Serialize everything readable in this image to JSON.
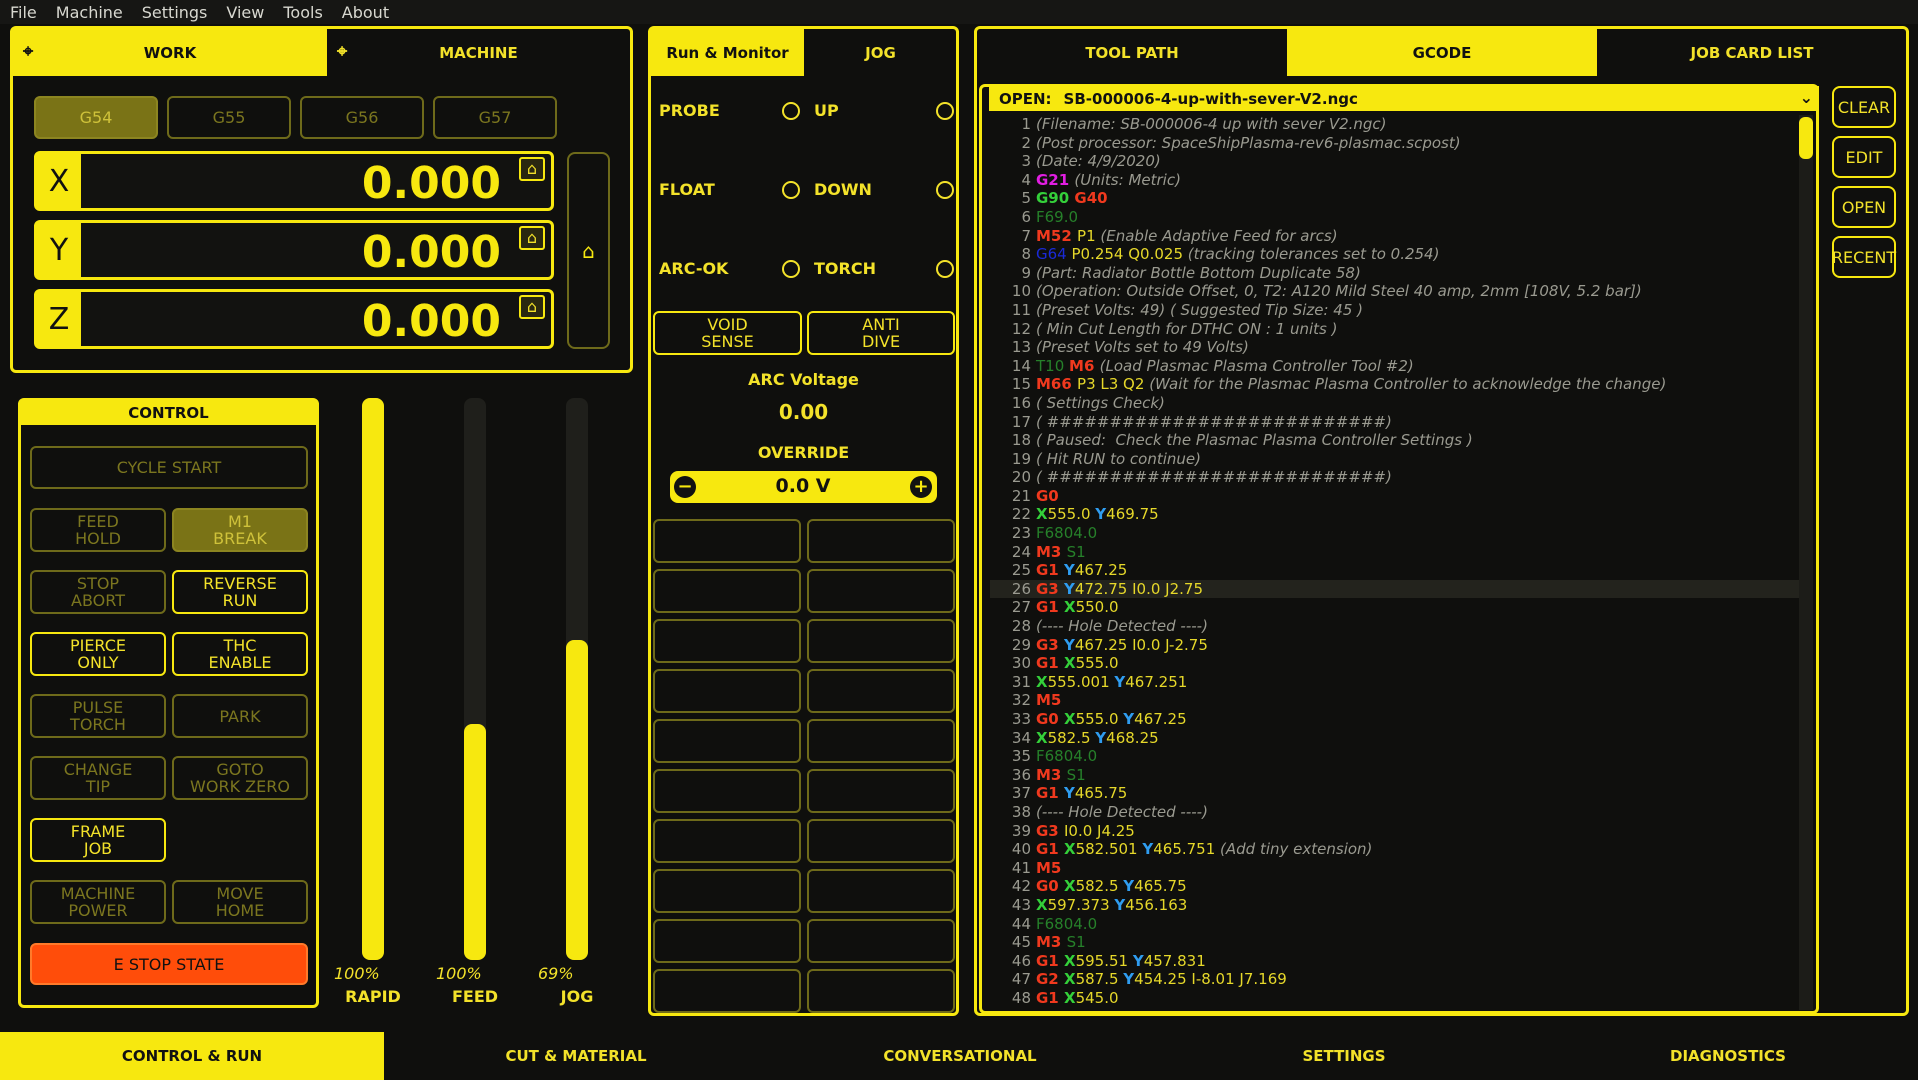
{
  "menu": [
    "File",
    "Machine",
    "Settings",
    "View",
    "Tools",
    "About"
  ],
  "dro": {
    "tabs": [
      {
        "label": "WORK",
        "active": true
      },
      {
        "label": "MACHINE",
        "active": false
      }
    ],
    "wcs": [
      {
        "label": "G54",
        "active": true
      },
      {
        "label": "G55",
        "active": false
      },
      {
        "label": "G56",
        "active": false
      },
      {
        "label": "G57",
        "active": false
      }
    ],
    "axes": [
      {
        "axis": "X",
        "value": "0.000"
      },
      {
        "axis": "Y",
        "value": "0.000"
      },
      {
        "axis": "Z",
        "value": "0.000"
      }
    ]
  },
  "control": {
    "title": "CONTROL",
    "cycle_start": "CYCLE START",
    "buttons": [
      {
        "label": "FEED\nHOLD",
        "state": "dim"
      },
      {
        "label": "M1\nBREAK",
        "state": "fill"
      },
      {
        "label": "STOP\nABORT",
        "state": "dim"
      },
      {
        "label": "REVERSE\nRUN",
        "state": "on"
      },
      {
        "label": "PIERCE\nONLY",
        "state": "on"
      },
      {
        "label": "THC\nENABLE",
        "state": "on"
      },
      {
        "label": "PULSE\nTORCH",
        "state": "dim"
      },
      {
        "label": "PARK",
        "state": "dim"
      },
      {
        "label": "CHANGE\nTIP",
        "state": "dim"
      },
      {
        "label": "GOTO\nWORK ZERO",
        "state": "dim"
      },
      {
        "label": "FRAME\nJOB",
        "state": "on"
      },
      {
        "label": "MACHINE\nPOWER",
        "state": "dim"
      },
      {
        "label": "MOVE\nHOME",
        "state": "dim"
      }
    ],
    "estop": "E STOP STATE"
  },
  "sliders": [
    {
      "label": "RAPID",
      "percent_text": "100%",
      "percent": 100
    },
    {
      "label": "FEED",
      "percent_text": "100%",
      "percent": 42
    },
    {
      "label": "JOG",
      "percent_text": "69%",
      "percent": 57
    }
  ],
  "monitor": {
    "tabs": [
      {
        "label": "Run & Monitor",
        "active": true
      },
      {
        "label": "JOG",
        "active": false
      }
    ],
    "io": [
      {
        "name": "PROBE"
      },
      {
        "name": "UP"
      },
      {
        "name": "FLOAT"
      },
      {
        "name": "DOWN"
      },
      {
        "name": "ARC-OK"
      },
      {
        "name": "TORCH"
      }
    ],
    "void_sense": "VOID\nSENSE",
    "anti_dive": "ANTI\nDIVE",
    "arc_voltage_label": "ARC Voltage",
    "arc_voltage": "0.00",
    "override_label": "OVERRIDE",
    "override_value": "0.0 V",
    "macro_count": 20
  },
  "gcode_panel": {
    "tabs": [
      {
        "label": "TOOL PATH",
        "active": false
      },
      {
        "label": "GCODE",
        "active": true
      },
      {
        "label": "JOB CARD LIST",
        "active": false
      }
    ],
    "open_prefix": "OPEN:",
    "open_file": "SB-000006-4-up-with-sever-V2.ngc",
    "side_buttons": [
      "CLEAR",
      "EDIT",
      "OPEN",
      "RECENT"
    ],
    "highlight_line": 26,
    "lines": [
      [
        [
          "c",
          "(Filename: SB-000006-4 up with sever V2.ngc)"
        ]
      ],
      [
        [
          "c",
          "(Post processor: SpaceShipPlasma-rev6-plasmac.scpost)"
        ]
      ],
      [
        [
          "c",
          "(Date: 4/9/2020)"
        ]
      ],
      [
        [
          "U",
          "G21 "
        ],
        [
          "c",
          "(Units: Metric)"
        ]
      ],
      [
        [
          "X",
          "G90 "
        ],
        [
          "G",
          "G40"
        ]
      ],
      [
        [
          "F",
          "F69.0"
        ]
      ],
      [
        [
          "M",
          "M52 "
        ],
        [
          "P",
          "P1 "
        ],
        [
          "c",
          "(Enable Adaptive Feed for arcs)"
        ]
      ],
      [
        [
          "O",
          "G64 "
        ],
        [
          "P",
          "P0.254 Q0.025 "
        ],
        [
          "c",
          "(tracking tolerances set to 0.254)"
        ]
      ],
      [
        [
          "c",
          "(Part: Radiator Bottle Bottom Duplicate 58)"
        ]
      ],
      [
        [
          "c",
          "(Operation: Outside Offset, 0, T2: A120 Mild Steel 40 amp, 2mm [108V, 5.2 bar])"
        ]
      ],
      [
        [
          "c",
          "(Preset Volts: 49) ( Suggested Tip Size: 45 )"
        ]
      ],
      [
        [
          "c",
          "( Min Cut Length for DTHC ON : 1 units )"
        ]
      ],
      [
        [
          "c",
          "(Preset Volts set to 49 Volts)"
        ]
      ],
      [
        [
          "T",
          "T10 "
        ],
        [
          "M",
          "M6 "
        ],
        [
          "c",
          "(Load Plasmac Plasma Controller Tool #2)"
        ]
      ],
      [
        [
          "M",
          "M66 "
        ],
        [
          "P",
          "P3 L3 Q2 "
        ],
        [
          "c",
          "(Wait for the Plasmac Plasma Controller to acknowledge the change)"
        ]
      ],
      [
        [
          "c",
          "( Settings Check)"
        ]
      ],
      [
        [
          "c",
          "( ###########################)"
        ]
      ],
      [
        [
          "c",
          "( Paused:  Check the Plasmac Plasma Controller Settings )"
        ]
      ],
      [
        [
          "c",
          "( Hit RUN to continue)"
        ]
      ],
      [
        [
          "c",
          "( ###########################)"
        ]
      ],
      [
        [
          "G",
          "G0"
        ]
      ],
      [
        [
          "X",
          "X"
        ],
        [
          "A",
          "555.0 "
        ],
        [
          "Y",
          "Y"
        ],
        [
          "A",
          "469.75"
        ]
      ],
      [
        [
          "F",
          "F6804.0"
        ]
      ],
      [
        [
          "M",
          "M3 "
        ],
        [
          "S",
          "S1"
        ]
      ],
      [
        [
          "G",
          "G1 "
        ],
        [
          "Y",
          "Y"
        ],
        [
          "A",
          "467.25"
        ]
      ],
      [
        [
          "G",
          "G3 "
        ],
        [
          "Y",
          "Y"
        ],
        [
          "A",
          "472.75 I0.0 J2.75"
        ]
      ],
      [
        [
          "G",
          "G1 "
        ],
        [
          "X",
          "X"
        ],
        [
          "A",
          "550.0"
        ]
      ],
      [
        [
          "c",
          "(---- Hole Detected ----)"
        ]
      ],
      [
        [
          "G",
          "G3 "
        ],
        [
          "Y",
          "Y"
        ],
        [
          "A",
          "467.25 I0.0 J-2.75"
        ]
      ],
      [
        [
          "G",
          "G1 "
        ],
        [
          "X",
          "X"
        ],
        [
          "A",
          "555.0"
        ]
      ],
      [
        [
          "X",
          "X"
        ],
        [
          "A",
          "555.001 "
        ],
        [
          "Y",
          "Y"
        ],
        [
          "A",
          "467.251"
        ]
      ],
      [
        [
          "M",
          "M5"
        ]
      ],
      [
        [
          "G",
          "G0 "
        ],
        [
          "X",
          "X"
        ],
        [
          "A",
          "555.0 "
        ],
        [
          "Y",
          "Y"
        ],
        [
          "A",
          "467.25"
        ]
      ],
      [
        [
          "X",
          "X"
        ],
        [
          "A",
          "582.5 "
        ],
        [
          "Y",
          "Y"
        ],
        [
          "A",
          "468.25"
        ]
      ],
      [
        [
          "F",
          "F6804.0"
        ]
      ],
      [
        [
          "M",
          "M3 "
        ],
        [
          "S",
          "S1"
        ]
      ],
      [
        [
          "G",
          "G1 "
        ],
        [
          "Y",
          "Y"
        ],
        [
          "A",
          "465.75"
        ]
      ],
      [
        [
          "c",
          "(---- Hole Detected ----)"
        ]
      ],
      [
        [
          "G",
          "G3 "
        ],
        [
          "A",
          "I0.0 J4.25"
        ]
      ],
      [
        [
          "G",
          "G1 "
        ],
        [
          "X",
          "X"
        ],
        [
          "A",
          "582.501 "
        ],
        [
          "Y",
          "Y"
        ],
        [
          "A",
          "465.751 "
        ],
        [
          "c",
          "(Add tiny extension)"
        ]
      ],
      [
        [
          "M",
          "M5"
        ]
      ],
      [
        [
          "G",
          "G0 "
        ],
        [
          "X",
          "X"
        ],
        [
          "A",
          "582.5 "
        ],
        [
          "Y",
          "Y"
        ],
        [
          "A",
          "465.75"
        ]
      ],
      [
        [
          "X",
          "X"
        ],
        [
          "A",
          "597.373 "
        ],
        [
          "Y",
          "Y"
        ],
        [
          "A",
          "456.163"
        ]
      ],
      [
        [
          "F",
          "F6804.0"
        ]
      ],
      [
        [
          "M",
          "M3 "
        ],
        [
          "S",
          "S1"
        ]
      ],
      [
        [
          "G",
          "G1 "
        ],
        [
          "X",
          "X"
        ],
        [
          "A",
          "595.51 "
        ],
        [
          "Y",
          "Y"
        ],
        [
          "A",
          "457.831"
        ]
      ],
      [
        [
          "G",
          "G2 "
        ],
        [
          "X",
          "X"
        ],
        [
          "A",
          "587.5 "
        ],
        [
          "Y",
          "Y"
        ],
        [
          "A",
          "454.25 I-8.01 J7.169"
        ]
      ],
      [
        [
          "G",
          "G1 "
        ],
        [
          "X",
          "X"
        ],
        [
          "A",
          "545.0"
        ]
      ]
    ]
  },
  "bottom_tabs": [
    {
      "label": "CONTROL & RUN",
      "active": true
    },
    {
      "label": "CUT & MATERIAL",
      "active": false
    },
    {
      "label": "CONVERSATIONAL",
      "active": false
    },
    {
      "label": "SETTINGS",
      "active": false
    },
    {
      "label": "DIAGNOSTICS",
      "active": false
    }
  ],
  "colors": {
    "accent": "#f7e80f",
    "background": "#0f0f0d",
    "estop": "#ff4d0a",
    "dim": "#7b761f"
  }
}
